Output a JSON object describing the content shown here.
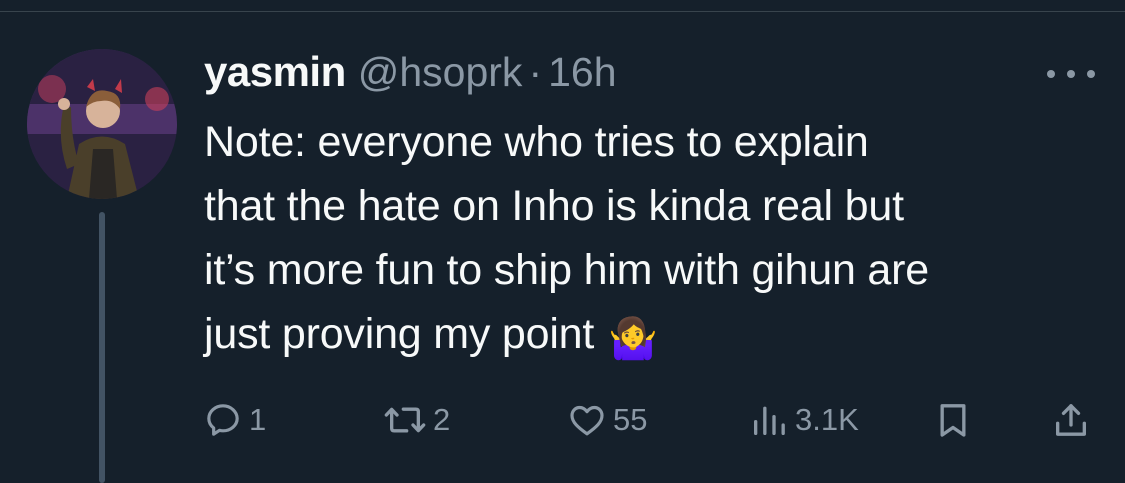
{
  "tweet": {
    "display_name": "yasmin",
    "handle": "@hsoprk",
    "separator": "·",
    "time": "16h",
    "text_lines": [
      "Note: everyone who tries to explain",
      "that the hate on Inho is kinda real but",
      "it’s more fun to ship him with gihun are",
      "just proving my point"
    ],
    "emoji": "🤷‍♀️"
  },
  "actions": {
    "replies": "1",
    "reposts": "2",
    "likes": "55",
    "views": "3.1K"
  },
  "icons": [
    "more-icon",
    "reply-icon",
    "repost-icon",
    "like-icon",
    "views-icon",
    "bookmark-icon",
    "share-icon"
  ],
  "colors": {
    "background": "#15202b",
    "text": "#f7f9f9",
    "muted": "#8b98a5",
    "thread_line": "#425364"
  }
}
